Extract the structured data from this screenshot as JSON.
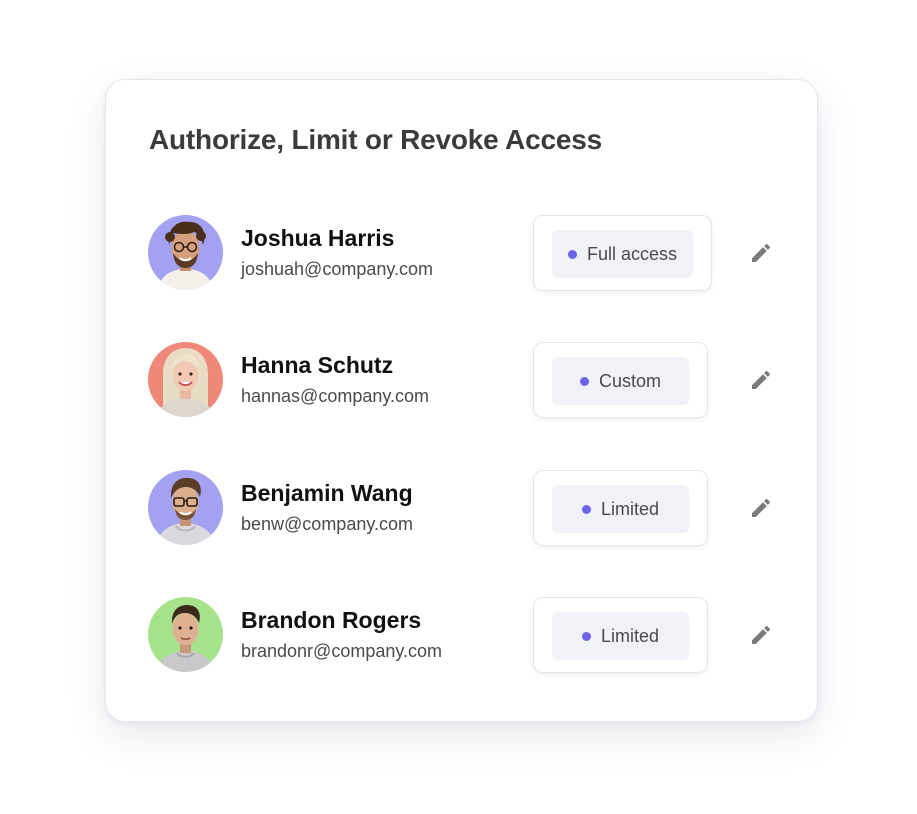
{
  "title": "Authorize, Limit or Revoke Access",
  "colors": {
    "accent": "#6b63e8",
    "icon": "#7a7a7a",
    "badge_bg": "#f0f2f7"
  },
  "users": [
    {
      "name": "Joshua Harris",
      "email": "joshuah@company.com",
      "access": "Full access",
      "avatar_bg": "#a4a1f3",
      "edit_icon": "pencil-icon"
    },
    {
      "name": "Hanna Schutz",
      "email": "hannas@company.com",
      "access": "Custom",
      "avatar_bg": "#f0887a",
      "edit_icon": "pencil-icon"
    },
    {
      "name": "Benjamin Wang",
      "email": "benw@company.com",
      "access": "Limited",
      "avatar_bg": "#a4a1f3",
      "edit_icon": "pencil-icon"
    },
    {
      "name": "Brandon Rogers",
      "email": "brandonr@company.com",
      "access": "Limited",
      "avatar_bg": "#a6e28c",
      "edit_icon": "pencil-icon"
    }
  ]
}
